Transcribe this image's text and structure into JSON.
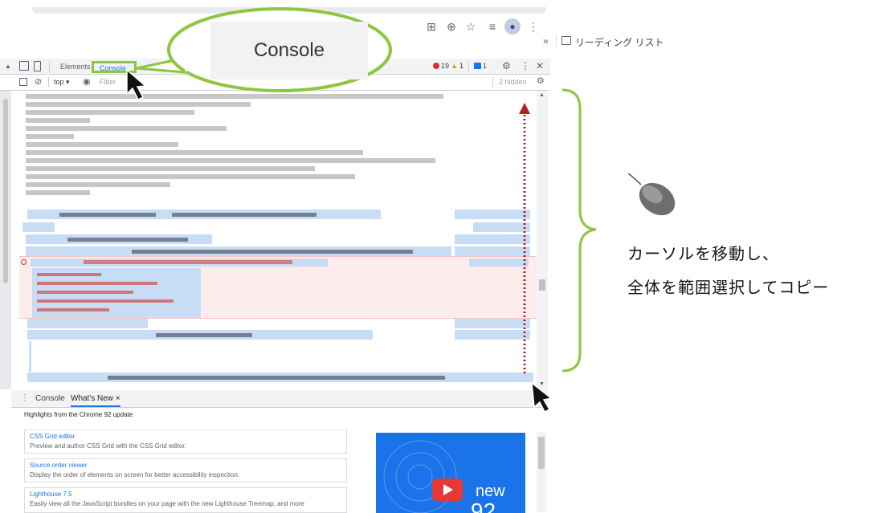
{
  "browser": {
    "reading_list_label": "リーディング リスト",
    "overflow_chevron": "»"
  },
  "devtools": {
    "tabs": [
      "Elements",
      "Console"
    ],
    "error_count": "19",
    "warning_count": "1",
    "info_count": "1",
    "context_select": "top ▾",
    "filter_placeholder": "Filter",
    "hidden_label": "2 hidden"
  },
  "drawer": {
    "tab_console": "Console",
    "tab_whats_new": "What's New ×",
    "highlights": "Highlights from the Chrome 92 update",
    "cards": [
      {
        "title": "CSS Grid editor",
        "desc": "Preview and author CSS Grid with the CSS Grid editor."
      },
      {
        "title": "Source order viewer",
        "desc": "Display the order of elements on screen for better accessibility inspection."
      },
      {
        "title": "Lighthouse 7.5",
        "desc": "Easily view all the JavaScript bundles on your page with the new Lighthouse Treemap, and more"
      }
    ],
    "promo_word": "new",
    "promo_number": "92"
  },
  "callout": {
    "label": "Console"
  },
  "annotation": {
    "line1": "カーソルを移動し、",
    "line2": "全体を範囲選択してコピー"
  },
  "colors": {
    "callout_green": "#8dc63f",
    "selection_blue": "#c7ddf6",
    "error_red": "#d93025",
    "arrow_red": "#b22222",
    "link_blue": "#1a73e8"
  },
  "icons": [
    "extension-icon",
    "zoom-icon",
    "star-icon",
    "reading-list-icon",
    "profile-icon",
    "menu-icon",
    "inspect-icon",
    "device-icon",
    "settings-icon",
    "close-icon",
    "clear-icon",
    "eye-icon",
    "mouse-icon"
  ]
}
